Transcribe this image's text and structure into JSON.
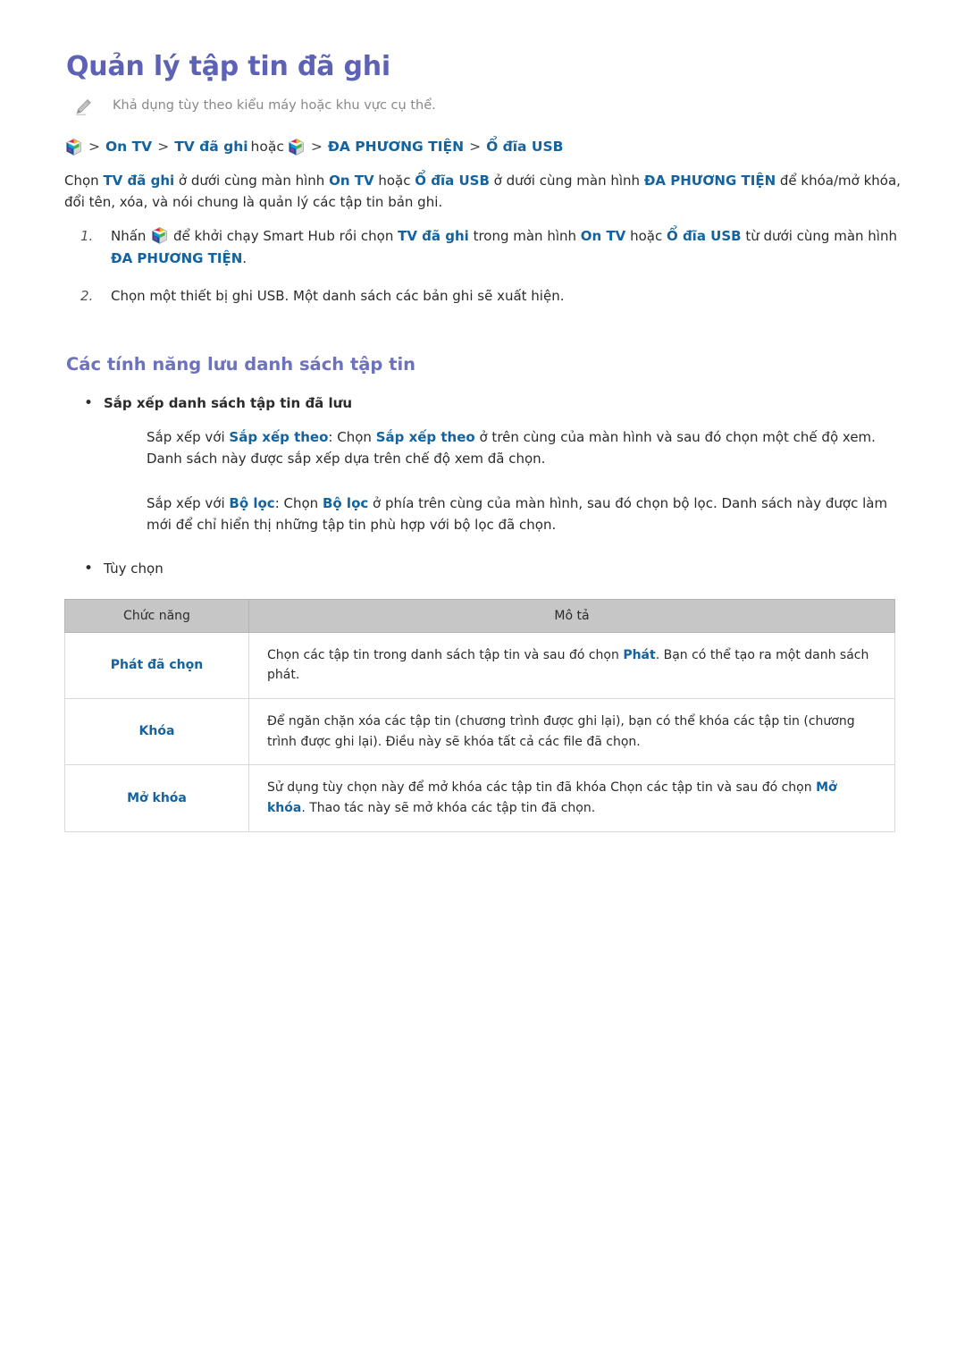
{
  "page": {
    "title": "Quản lý tập tin đã ghi",
    "note": {
      "icon": "pencil-icon",
      "text": "Khả dụng tùy theo kiểu máy hoặc khu vực cụ thể."
    },
    "breadcrumb": {
      "icon": "smart-hub-cube-icon",
      "items": [
        "On TV",
        "TV đã ghi",
        "ĐA PHƯƠNG TIỆN",
        "Ổ đĩa USB"
      ],
      "separator": ">",
      "conjunction": "hoặc"
    },
    "intro": {
      "part1": "Chọn ",
      "bold1": "TV đã ghi",
      "part2": " ở dưới cùng màn hình ",
      "bold2": "On TV",
      "part3": " hoặc ",
      "bold3": "Ổ đĩa USB",
      "part4": " ở dưới cùng màn hình ",
      "bold4": "ĐA PHƯƠNG TIỆN",
      "part5": " để khóa/mở khóa, đổi tên, xóa, và nói chung là quản lý các tập tin bản ghi."
    },
    "steps": [
      {
        "num": "1.",
        "p1": "Nhấn ",
        "p2": " để khởi chạy Smart Hub rồi chọn ",
        "b1": "TV đã ghi",
        "p3": " trong màn hình ",
        "b2": "On TV",
        "p4": " hoặc ",
        "b3": "Ổ đĩa USB",
        "p5": " từ dưới cùng màn hình ",
        "b4": "ĐA PHƯƠNG TIỆN",
        "p6": "."
      },
      {
        "num": "2.",
        "text": "Chọn một thiết bị ghi USB. Một danh sách các bản ghi sẽ xuất hiện."
      }
    ],
    "section": {
      "title": "Các tính năng lưu danh sách tập tin",
      "bullet_sort": "Sắp xếp danh sách tập tin đã lưu",
      "sort_by": {
        "p1": "Sắp xếp với ",
        "b1": "Sắp xếp theo",
        "p2": ": Chọn ",
        "b2": "Sắp xếp theo",
        "p3": " ở trên cùng của màn hình và sau đó chọn một chế độ xem. Danh sách này được sắp xếp dựa trên chế độ xem đã chọn."
      },
      "filter": {
        "p1": "Sắp xếp với ",
        "b1": "Bộ lọc",
        "p2": ": Chọn ",
        "b2": "Bộ lọc",
        "p3": " ở phía trên cùng của màn hình, sau đó chọn bộ lọc. Danh sách này được làm mới để chỉ hiển thị những tập tin phù hợp với bộ lọc đã chọn."
      },
      "bullet_options": "Tùy chọn"
    },
    "table": {
      "headers": [
        "Chức năng",
        "Mô tả"
      ],
      "rows": [
        {
          "func": "Phát đã chọn",
          "d1": "Chọn các tập tin trong danh sách tập tin và sau đó chọn ",
          "b1": "Phát",
          "d2": ". Bạn có thể tạo ra một danh sách phát."
        },
        {
          "func": "Khóa",
          "d1": "Để ngăn chặn xóa các tập tin (chương trình được ghi lại), bạn có thể khóa các tập tin (chương trình được ghi lại). Điều này sẽ khóa tất cả các file đã chọn.",
          "b1": "",
          "d2": ""
        },
        {
          "func": "Mở khóa",
          "d1": "Sử dụng tùy chọn này để mở khóa các tập tin đã khóa Chọn các tập tin và sau đó chọn ",
          "b1": "Mở khóa",
          "d2": ". Thao tác này sẽ mở khóa các tập tin đã chọn."
        }
      ]
    },
    "colors": {
      "title_purple": "#5d62b5",
      "section_purple": "#6d72bd",
      "accent_blue": "#12639f",
      "note_gray": "#888888",
      "table_header_gray": "#c6c6c6",
      "body_text": "#2b2b2b"
    }
  }
}
